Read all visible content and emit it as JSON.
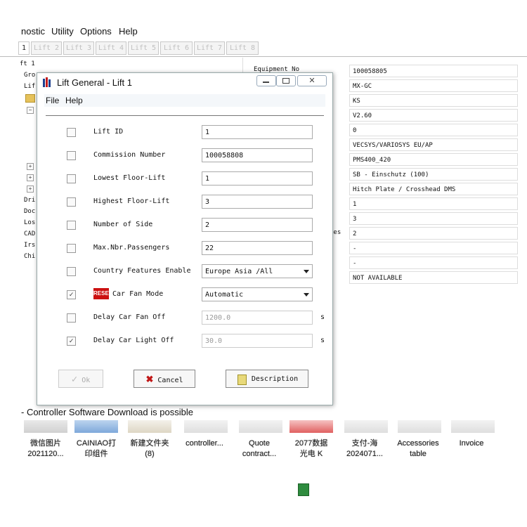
{
  "menubar": {
    "items": [
      "nostic",
      "Utility",
      "Options",
      "Help"
    ]
  },
  "tabs": {
    "first": "1",
    "items": [
      "Lift 2",
      "Lift 3",
      "Lift 4",
      "Lift 5",
      "Lift 6",
      "Lift 7",
      "Lift 8"
    ]
  },
  "tree": {
    "items": [
      "ft 1",
      "Gro",
      "Lif",
      "Dri",
      "Doc",
      "Los",
      "CAD",
      "Irs",
      "Chi"
    ],
    "plus": "+",
    "minus": "−"
  },
  "right_panel": {
    "labels": [
      "Equipment No",
      "des"
    ],
    "values": [
      "100058805",
      "MX-GC",
      "KS",
      "V2.60",
      "0",
      "VECSYS/VARIOSYS EU/AP",
      "PMS400_420",
      "SB - Einschutz (100)",
      "Hitch Plate / Crosshead DMS",
      "1",
      "3",
      "2",
      "-",
      "-",
      "NOT AVAILABLE"
    ]
  },
  "dialog": {
    "title": "Lift General - Lift 1",
    "menu": {
      "file": "File",
      "help": "Help"
    },
    "rows": [
      {
        "label": "Lift ID",
        "value": "1",
        "checked": false
      },
      {
        "label": "Commission Number",
        "value": "100058808",
        "checked": false
      },
      {
        "label": "Lowest Floor-Lift",
        "value": "1",
        "checked": false
      },
      {
        "label": "Highest Floor-Lift",
        "value": "3",
        "checked": false
      },
      {
        "label": "Number of Side",
        "value": "2",
        "checked": false
      },
      {
        "label": "Max.Nbr.Passengers",
        "value": "22",
        "checked": false
      },
      {
        "label": "Country Features Enable",
        "value": "Europe Asia /All",
        "checked": false
      },
      {
        "label": "Car Fan Mode",
        "value": "Automatic",
        "checked": true,
        "badge": "RESET"
      },
      {
        "label": "Delay Car Fan Off",
        "value": "1200.0",
        "checked": false,
        "unit": "s"
      },
      {
        "label": "Delay Car Light Off",
        "value": "30.0",
        "checked": true,
        "unit": "s"
      }
    ],
    "buttons": {
      "ok": "Ok",
      "cancel": "Cancel",
      "description": "Description"
    },
    "check_mark": "✓"
  },
  "status": {
    "text": "- Controller Software Download is possible"
  },
  "taskbar": {
    "items": [
      {
        "line1": "微信图片",
        "line2": "2021120..."
      },
      {
        "line1": "CAINIAO打",
        "line2": "印组件"
      },
      {
        "line1": "新建文件夹",
        "line2": "(8)"
      },
      {
        "line1": "controller...",
        "line2": ""
      },
      {
        "line1": "Quote",
        "line2": "contract..."
      },
      {
        "line1": "2077数据",
        "line2": "光电 K"
      },
      {
        "line1": "支付-海",
        "line2": "2024071..."
      },
      {
        "line1": "Accessories",
        "line2": "table"
      },
      {
        "line1": "Invoice",
        "line2": ""
      }
    ]
  },
  "colors": {
    "badge": "#cc1111",
    "accent": "#4a7bb7"
  }
}
